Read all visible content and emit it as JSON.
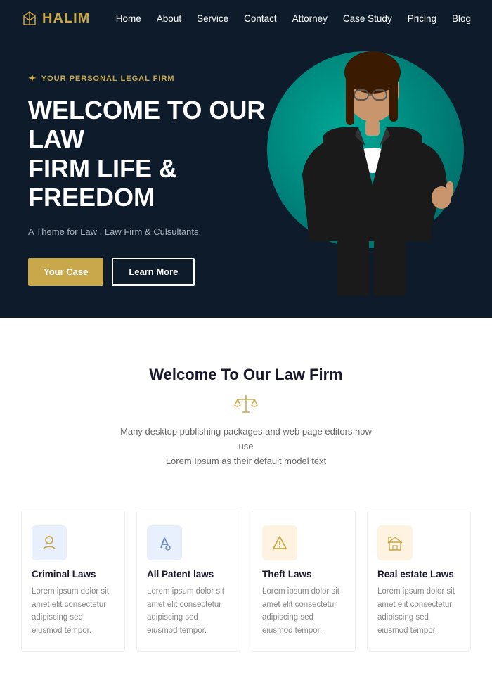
{
  "navbar": {
    "logo_text": "HALIM",
    "links": [
      {
        "label": "Home",
        "id": "home"
      },
      {
        "label": "About",
        "id": "about"
      },
      {
        "label": "Service",
        "id": "service"
      },
      {
        "label": "Contact",
        "id": "contact"
      },
      {
        "label": "Attorney",
        "id": "attorney"
      },
      {
        "label": "Case Study",
        "id": "case-study"
      },
      {
        "label": "Pricing",
        "id": "pricing"
      },
      {
        "label": "Blog",
        "id": "blog"
      }
    ]
  },
  "hero": {
    "tag": "YOUR PERSONAL LEGAL FIRM",
    "title_line1": "WELCOME TO OUR LAW",
    "title_line2": "FIRM LIFE & FREEDOM",
    "subtitle": "A Theme for Law , Law Firm & Culsultants.",
    "btn_primary": "Your Case",
    "btn_secondary": "Learn More"
  },
  "welcome": {
    "title": "Welcome To Our Law Firm",
    "divider_icon": "⚖",
    "text_line1": "Many desktop publishing packages and web page editors now use",
    "text_line2": "Lorem Ipsum as their default model text"
  },
  "services": [
    {
      "id": "criminal-laws",
      "icon": "👤",
      "icon_style": "blue",
      "title": "Criminal Laws",
      "text": "Lorem ipsum dolor sit amet elit consectetur adipiscing sed eiusmod tempor."
    },
    {
      "id": "patent-laws",
      "icon": "🔨",
      "icon_style": "blue",
      "title": "All Patent laws",
      "text": "Lorem ipsum dolor sit amet elit consectetur adipiscing sed eiusmod tempor."
    },
    {
      "id": "theft-laws",
      "icon": "▲",
      "icon_style": "gold",
      "title": "Theft Laws",
      "text": "Lorem ipsum dolor sit amet elit consectetur adipiscing sed eiusmod tempor."
    },
    {
      "id": "real-estate-laws",
      "icon": "🏠",
      "icon_style": "gold",
      "title": "Real estate Laws",
      "text": "Lorem ipsum dolor sit amet elit consectetur adipiscing sed eiusmod tempor."
    }
  ],
  "colors": {
    "accent": "#c9a84c",
    "dark_bg": "#0d1b2a",
    "teal": "#00a896"
  }
}
